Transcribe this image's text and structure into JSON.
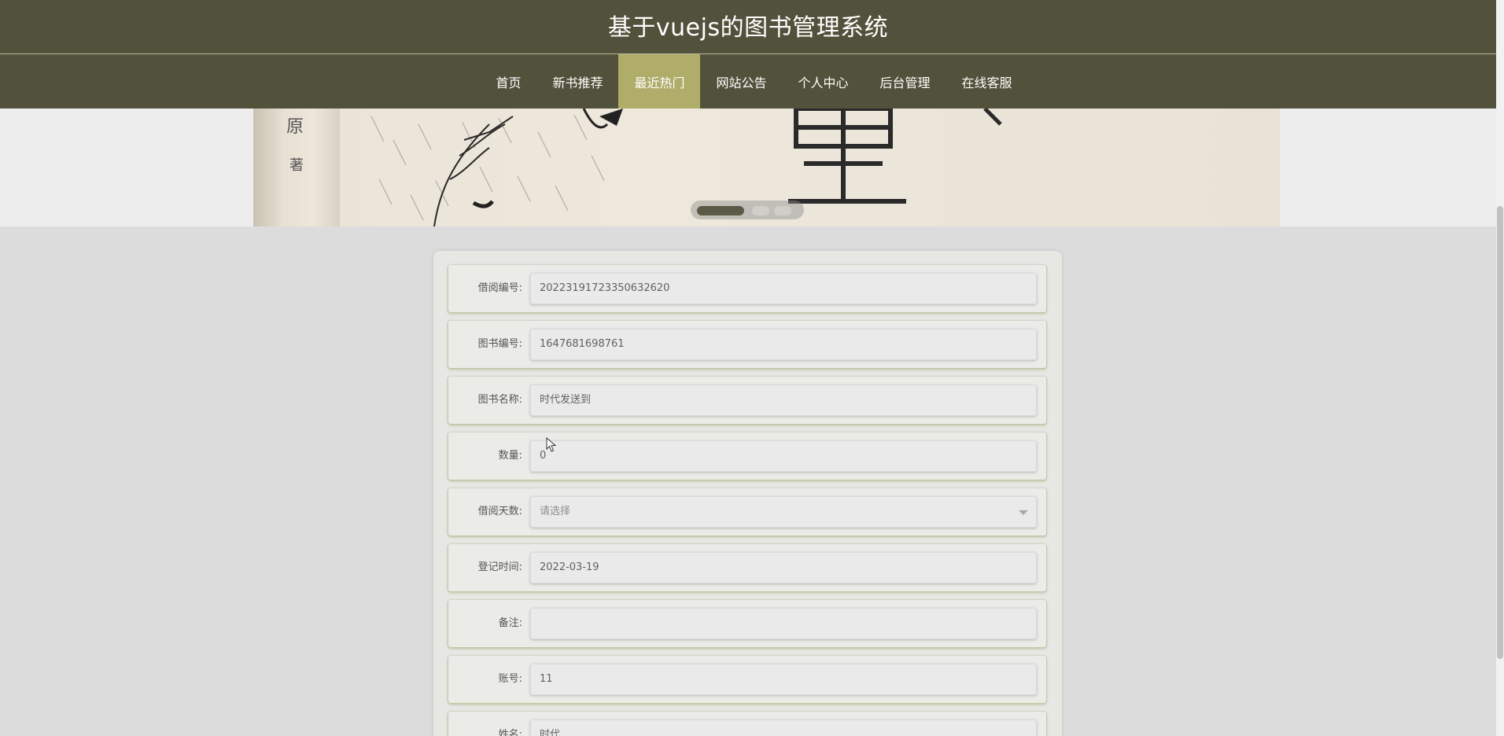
{
  "header": {
    "title": "基于vuejs的图书管理系统"
  },
  "nav": {
    "items": [
      {
        "label": "首页",
        "active": false
      },
      {
        "label": "新书推荐",
        "active": false
      },
      {
        "label": "最近热门",
        "active": true
      },
      {
        "label": "网站公告",
        "active": false
      },
      {
        "label": "个人中心",
        "active": false
      },
      {
        "label": "后台管理",
        "active": false
      },
      {
        "label": "在线客服",
        "active": false
      }
    ]
  },
  "banner": {
    "slide_count": 3,
    "active_slide": 1,
    "cover_text": [
      "原",
      "著"
    ]
  },
  "form": {
    "borrow_id": {
      "label": "借阅编号:",
      "value": "20223191723350632620"
    },
    "book_id": {
      "label": "图书编号:",
      "value": "1647681698761"
    },
    "book_name": {
      "label": "图书名称:",
      "value": "时代发送到"
    },
    "quantity": {
      "label": "数量:",
      "value": "0"
    },
    "borrow_days": {
      "label": "借阅天数:",
      "placeholder": "请选择"
    },
    "register_time": {
      "label": "登记时间:",
      "value": "2022-03-19"
    },
    "remark": {
      "label": "备注:",
      "value": ""
    },
    "account": {
      "label": "账号:",
      "value": "11"
    },
    "name": {
      "label": "姓名:",
      "value": "时代"
    }
  },
  "colors": {
    "header_bg": "#52523c",
    "nav_active_bg": "#b0ac6a",
    "page_bg": "#dcdcdc",
    "row_shadow": "#c6c6a0"
  }
}
